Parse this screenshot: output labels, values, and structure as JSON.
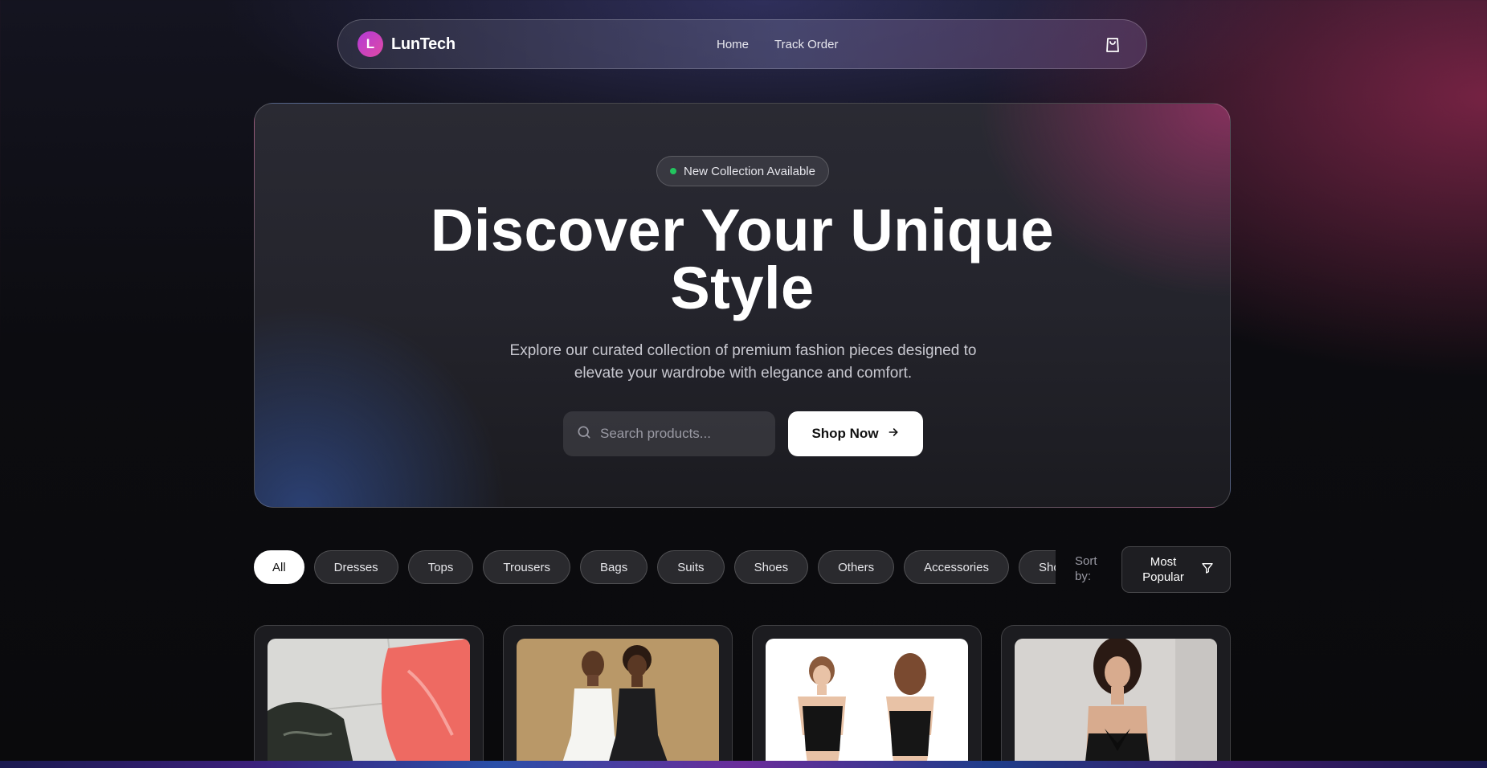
{
  "nav": {
    "logo_letter": "L",
    "brand": "LunTech",
    "links": [
      "Home",
      "Track Order"
    ],
    "cart_icon": "shopping-bag-icon"
  },
  "hero": {
    "badge": "New Collection Available",
    "headline_line1": "Discover Your Unique",
    "headline_line2": "Style",
    "subtext": "Explore our curated collection of premium fashion pieces designed to elevate your wardrobe with elegance and comfort.",
    "search_placeholder": "Search products...",
    "cta_label": "Shop Now"
  },
  "filters": {
    "categories": [
      "All",
      "Dresses",
      "Tops",
      "Trousers",
      "Bags",
      "Suits",
      "Shoes",
      "Others",
      "Accessories",
      "Shorts"
    ],
    "active": "All",
    "sort_label": "Sort by:",
    "sort_value": "Most Popular"
  },
  "colors": {
    "accent": "#c23fc8",
    "status_dot": "#22c55e",
    "cta_bg": "#ffffff"
  }
}
